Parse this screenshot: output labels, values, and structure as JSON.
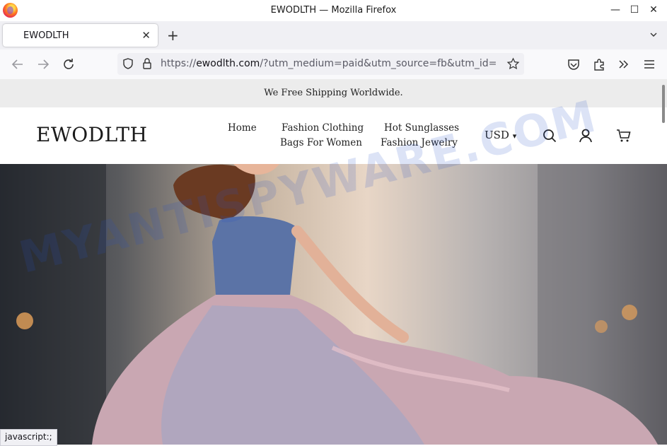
{
  "window": {
    "title": "EWODLTH — Mozilla Firefox",
    "controls": {
      "minimize": "—",
      "maximize": "☐",
      "close": "✕"
    }
  },
  "tab": {
    "label": "EWODLTH",
    "close_glyph": "✕",
    "new_tab_glyph": "+"
  },
  "address_bar": {
    "scheme": "https://",
    "host": "ewodlth.com",
    "path": "/?utm_medium=paid&utm_source=fb&utm_id="
  },
  "site": {
    "promo": "We Free Shipping Worldwide.",
    "brand": "EWODLTH",
    "menu": {
      "home": "Home",
      "fashion_clothing": "Fashion Clothing",
      "hot_sunglasses": "Hot Sunglasses",
      "bags_for_women": "Bags For Women",
      "fashion_jewelry": "Fashion Jewelry"
    },
    "currency": "USD",
    "currency_caret": "▾"
  },
  "watermark": "MYANTISPYWARE.COM",
  "status_bar": "javascript:;",
  "colors": {
    "tabbar": "#f0f0f4",
    "promo_bg": "#ececec",
    "text": "#222222"
  }
}
